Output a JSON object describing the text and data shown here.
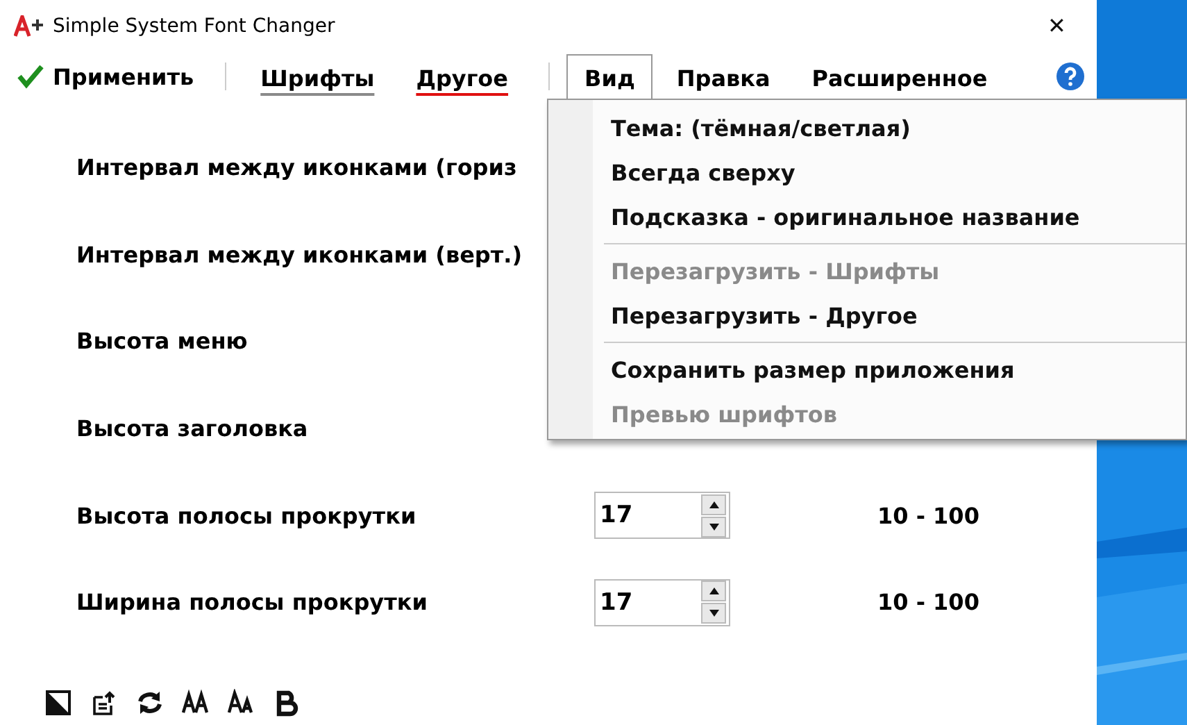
{
  "window": {
    "title": "Simple System Font Changer",
    "close": "✕"
  },
  "menubar": [
    {
      "kind": "apply",
      "label": "Применить",
      "selected": false
    },
    {
      "kind": "separator"
    },
    {
      "kind": "tab",
      "label": "Шрифты",
      "selected": false,
      "color": "#8a8a8a"
    },
    {
      "kind": "tab",
      "label": "Другое",
      "selected": false,
      "color": "#e01010"
    },
    {
      "kind": "separator"
    },
    {
      "kind": "tab",
      "label": "Вид",
      "selected": true
    },
    {
      "kind": "tab",
      "label": "Правка",
      "selected": false
    },
    {
      "kind": "tab",
      "label": "Расширенное",
      "selected": false
    },
    {
      "kind": "help"
    }
  ],
  "rows": [
    {
      "label": "Интервал между иконками (гориз"
    },
    {
      "label": "Интервал между иконками (верт.)"
    },
    {
      "label": "Высота меню"
    },
    {
      "label": "Высота заголовка"
    },
    {
      "label": "Высота полосы прокрутки",
      "value": "17",
      "range": "10 - 100"
    },
    {
      "label": "Ширина полосы прокрутки",
      "value": "17",
      "range": "10 - 100"
    }
  ],
  "menu": [
    {
      "kind": "item",
      "label": "Тема: (тёмная/светлая)",
      "disabled": false
    },
    {
      "kind": "item",
      "label": "Всегда сверху",
      "disabled": false
    },
    {
      "kind": "item",
      "label": "Подсказка - оригинальное название",
      "disabled": false
    },
    {
      "kind": "separator"
    },
    {
      "kind": "item",
      "label": "Перезагрузить - Шрифты",
      "disabled": true
    },
    {
      "kind": "item",
      "label": "Перезагрузить - Другое",
      "disabled": false
    },
    {
      "kind": "separator"
    },
    {
      "kind": "item",
      "label": "Сохранить размер приложения",
      "disabled": false
    },
    {
      "kind": "item",
      "label": "Превью шрифтов",
      "disabled": true
    }
  ]
}
